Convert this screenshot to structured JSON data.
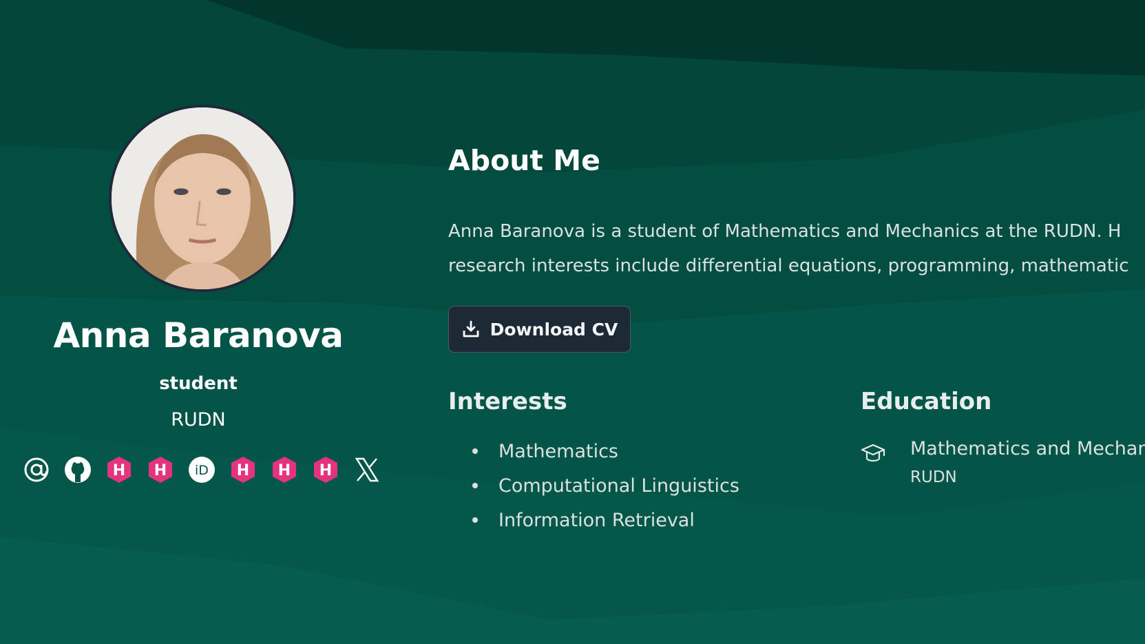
{
  "profile": {
    "name": "Anna Baranova",
    "role": "student",
    "organization": "RUDN",
    "avatar_icon": "profile-photo"
  },
  "social_links": [
    {
      "icon": "at-email-icon"
    },
    {
      "icon": "github-icon"
    },
    {
      "icon": "hal-icon",
      "glyph": "H"
    },
    {
      "icon": "hal-icon",
      "glyph": "H"
    },
    {
      "icon": "orcid-icon",
      "glyph": "iD"
    },
    {
      "icon": "hal-icon",
      "glyph": "H"
    },
    {
      "icon": "hal-icon",
      "glyph": "H"
    },
    {
      "icon": "hal-icon",
      "glyph": "H"
    },
    {
      "icon": "x-twitter-icon"
    }
  ],
  "about": {
    "title": "About Me",
    "bio_line_1": "Anna Baranova is a student of Mathematics and Mechanics at the RUDN. H",
    "bio_line_2": "research interests include differential equations, programming, mathematic",
    "cv_button_label": "Download CV",
    "cv_icon": "download-icon"
  },
  "interests": {
    "title": "Interests",
    "items": [
      "Mathematics",
      "Computational Linguistics",
      "Information Retrieval"
    ]
  },
  "education": {
    "title": "Education",
    "icon": "graduation-cap-icon",
    "degree": "Mathematics and Mechan",
    "institution": "RUDN"
  },
  "colors": {
    "background": "#055448",
    "background_dark": "#03392f",
    "hal_pink": "#e6337e",
    "button_bg": "#1d2a36",
    "text": "#ffffff"
  }
}
